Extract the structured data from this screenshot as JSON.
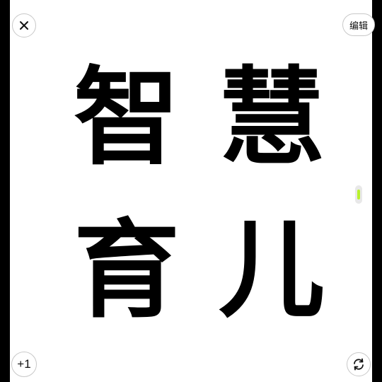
{
  "canvas": {
    "words": [
      "智",
      "慧",
      "育",
      "儿"
    ]
  },
  "controls": {
    "close_icon": "close-icon",
    "edit_label": "编辑",
    "plus_label": "+1",
    "rotate_icon": "rotate-icon"
  },
  "colors": {
    "background": "#000000",
    "canvas": "#ffffff",
    "text": "#000000",
    "indicator": "#b9f22c"
  }
}
